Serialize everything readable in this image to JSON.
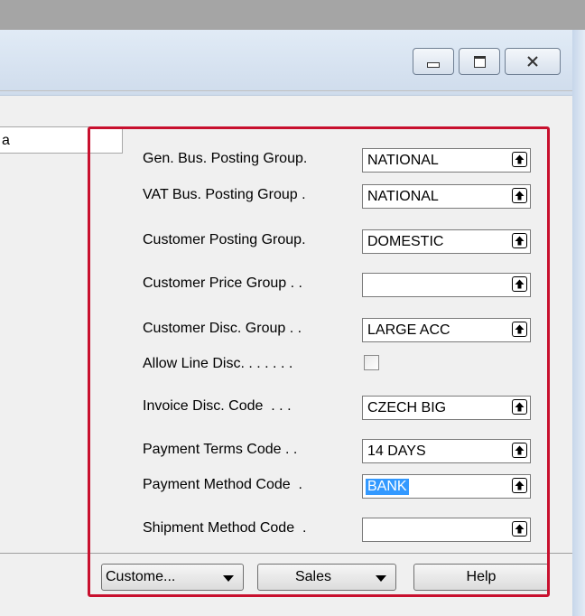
{
  "window": {
    "left_field_value": "a"
  },
  "form": {
    "fields": [
      {
        "label": "Gen. Bus. Posting Group.",
        "value": "NATIONAL"
      },
      {
        "label": "VAT Bus. Posting Group .",
        "value": "NATIONAL"
      },
      {
        "label": "Customer Posting Group.",
        "value": "DOMESTIC"
      },
      {
        "label": "Customer Price Group . .",
        "value": ""
      },
      {
        "label": "Customer Disc. Group . .",
        "value": "LARGE ACC"
      },
      {
        "label": "Allow Line Disc. . . . . . .",
        "checked": false
      },
      {
        "label": "Invoice Disc. Code  . . .",
        "value": "CZECH BIG"
      },
      {
        "label": "Payment Terms Code . .",
        "value": "14 DAYS"
      },
      {
        "label": "Payment Method Code  .",
        "value": "BANK",
        "selected": true
      },
      {
        "label": "Shipment Method Code  .",
        "value": ""
      }
    ]
  },
  "buttons": {
    "customer_label": "Custome...",
    "sales_label": "Sales",
    "help_label": "Help"
  },
  "colors": {
    "highlight_border": "#c8102e",
    "selection": "#3399ff"
  },
  "icons": [
    "minimize-icon",
    "maximize-icon",
    "close-icon",
    "lookup-icon",
    "dropdown-arrow-icon"
  ]
}
